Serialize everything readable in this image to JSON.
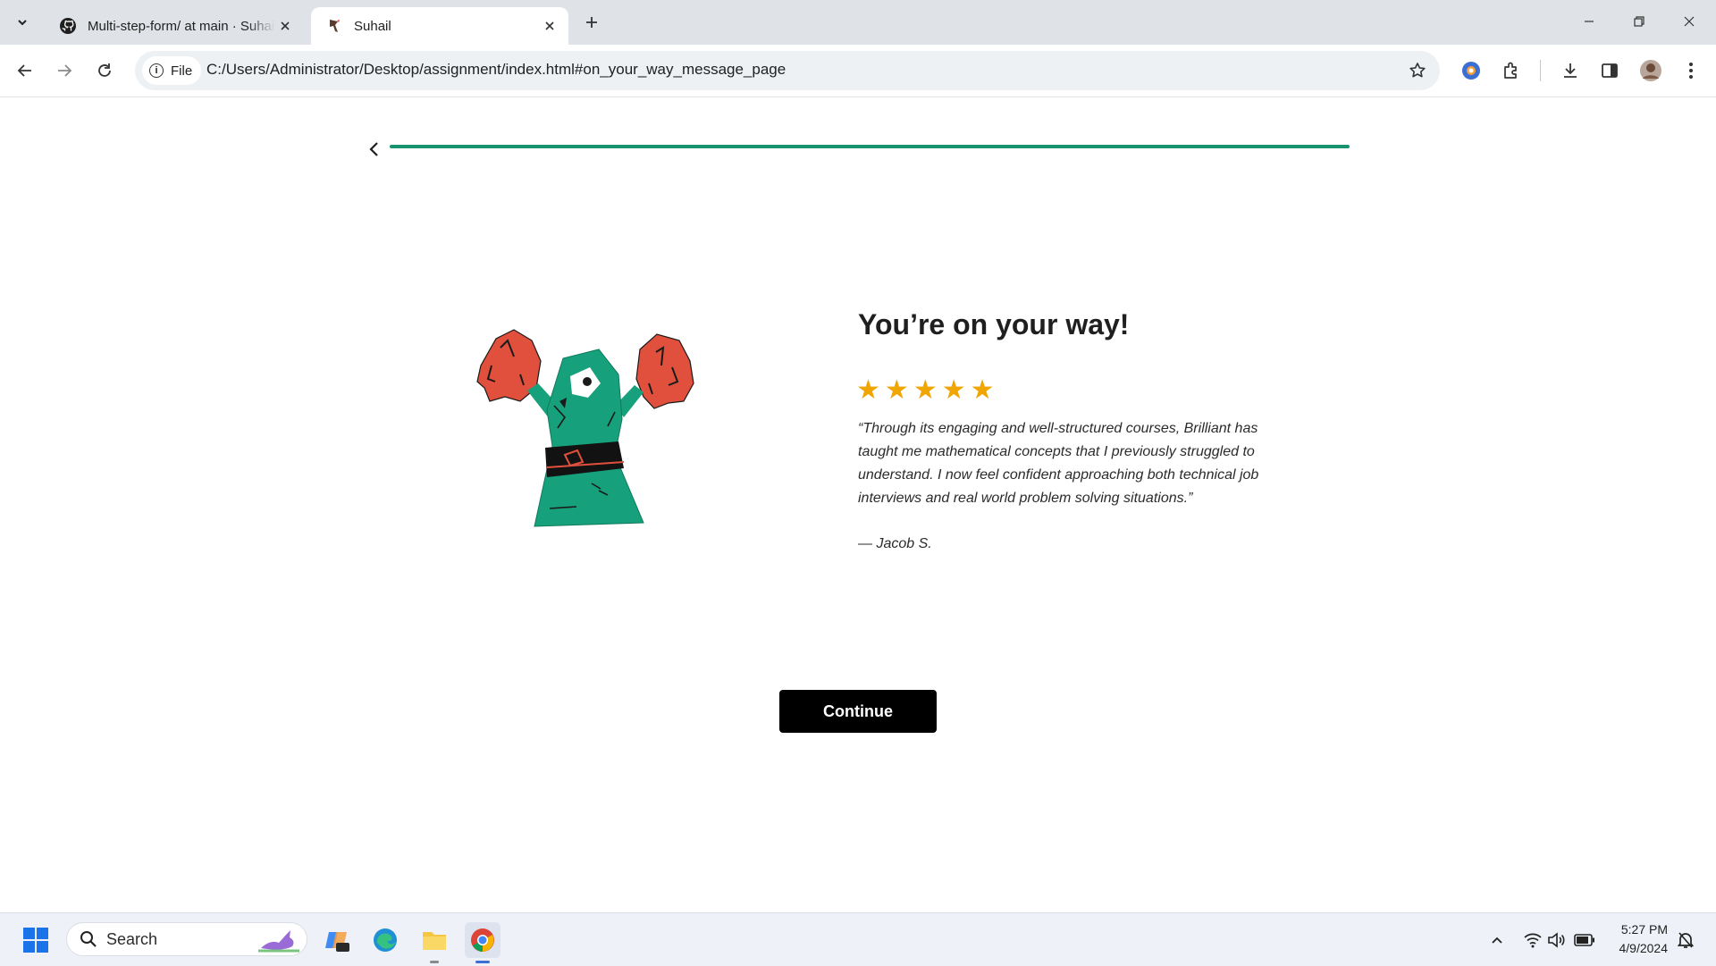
{
  "browser": {
    "tabs": [
      {
        "title": "Multi-step-form/ at main · Suhail",
        "active": false
      },
      {
        "title": "Suhail",
        "active": true
      }
    ],
    "address": {
      "scheme_chip": "File",
      "url": "C:/Users/Administrator/Desktop/assignment/index.html#on_your_way_message_page"
    }
  },
  "page": {
    "progress": 1.0,
    "headline": "You’re on your way!",
    "rating": 5,
    "star_glyphs": [
      "★",
      "★",
      "★",
      "★",
      "★"
    ],
    "quote": "“Through its engaging and well-structured courses, Brilliant has taught me mathematical concepts that I previously struggled to understand. I now feel confident approaching both technical job interviews and real world problem solving situations.”",
    "author": "— Jacob S.",
    "continue_label": "Continue",
    "colors": {
      "accent": "#17936f",
      "star": "#f0a500",
      "monster_body": "#17a07c",
      "monster_hands": "#e0503c"
    }
  },
  "taskbar": {
    "search_placeholder": "Search",
    "time": "5:27 PM",
    "date": "4/9/2024"
  }
}
